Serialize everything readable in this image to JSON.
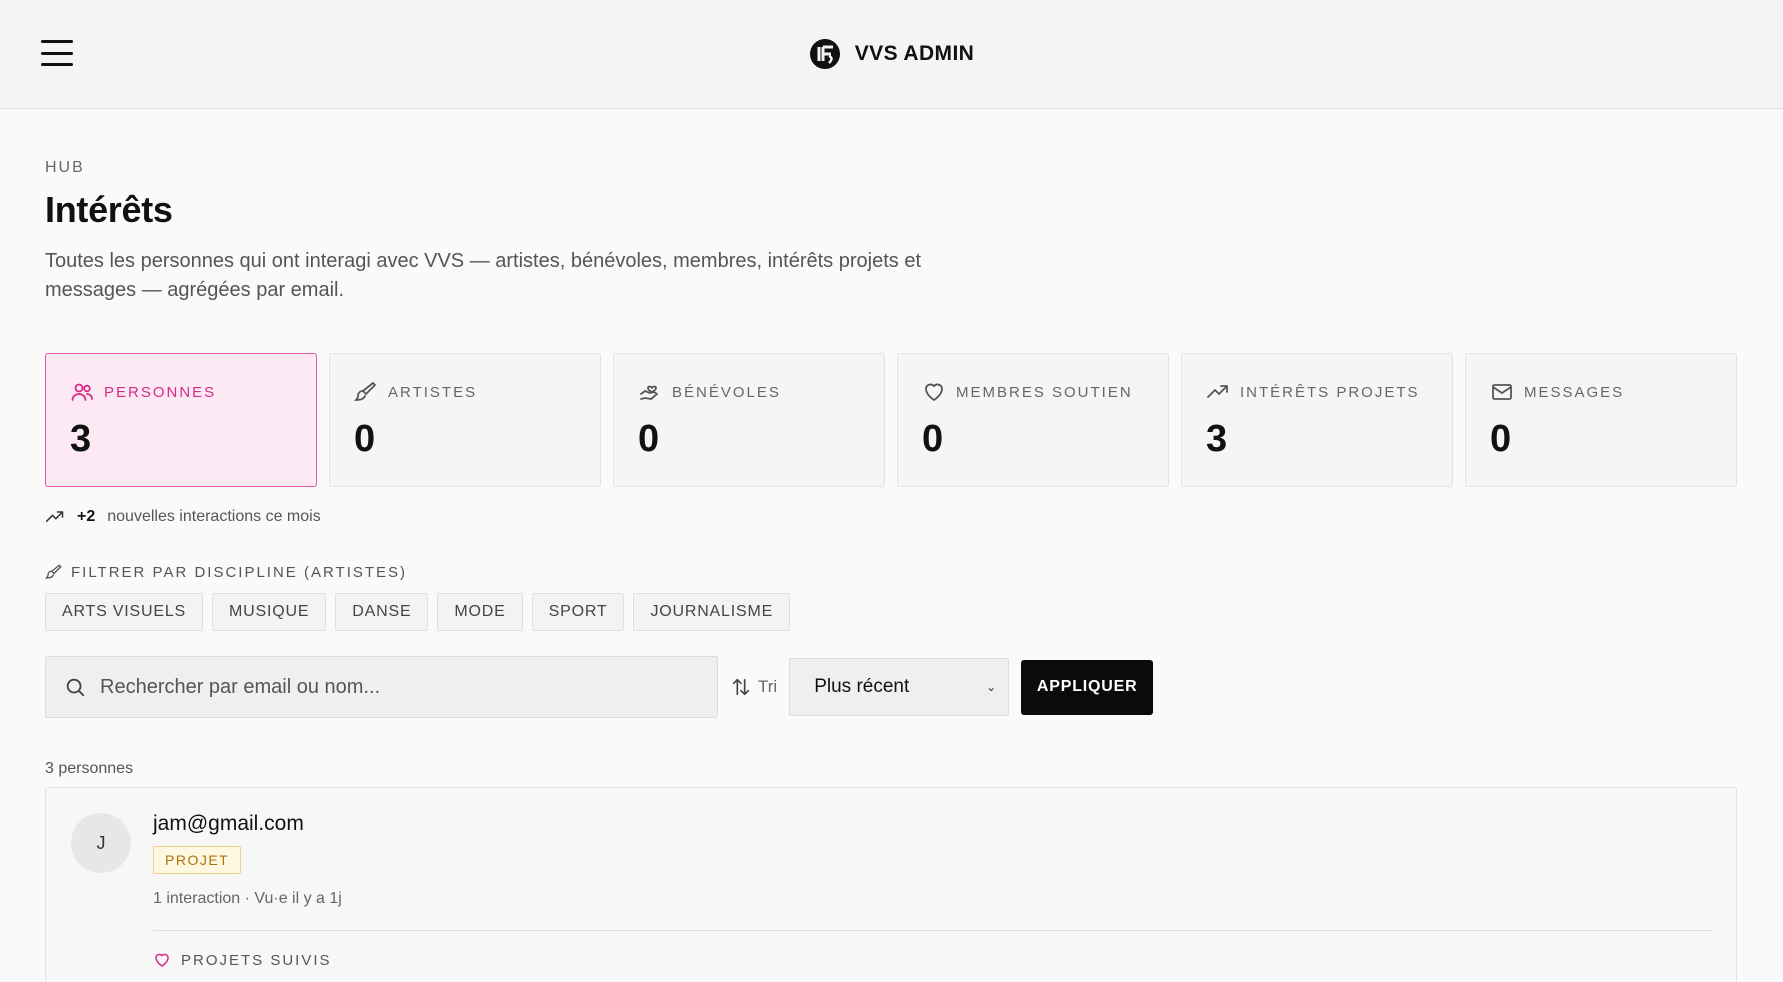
{
  "app": {
    "name": "VVS ADMIN"
  },
  "header": {
    "eyebrow": "HUB",
    "title": "Intérêts",
    "subtitle": "Toutes les personnes qui ont interagi avec VVS — artistes, bénévoles, membres, intérêts projets et messages — agrégées par email."
  },
  "stats": [
    {
      "label": "PERSONNES",
      "value": "3",
      "icon": "users-icon",
      "active": true
    },
    {
      "label": "ARTISTES",
      "value": "0",
      "icon": "brush-icon",
      "active": false
    },
    {
      "label": "BÉNÉVOLES",
      "value": "0",
      "icon": "hand-heart-icon",
      "active": false
    },
    {
      "label": "MEMBRES SOUTIEN",
      "value": "0",
      "icon": "heart-icon",
      "active": false
    },
    {
      "label": "INTÉRÊTS PROJETS",
      "value": "3",
      "icon": "trending-up-icon",
      "active": false
    },
    {
      "label": "MESSAGES",
      "value": "0",
      "icon": "mail-icon",
      "active": false
    }
  ],
  "trend": {
    "delta": "+2",
    "text": "nouvelles interactions ce mois"
  },
  "filter": {
    "label": "FILTRER PAR DISCIPLINE (ARTISTES)",
    "chips": [
      "ARTS VISUELS",
      "MUSIQUE",
      "DANSE",
      "MODE",
      "SPORT",
      "JOURNALISME"
    ]
  },
  "search": {
    "placeholder": "Rechercher par email ou nom...",
    "value": ""
  },
  "sort": {
    "label": "Tri",
    "selected": "Plus récent"
  },
  "apply_label": "APPLIQUER",
  "results": {
    "count_text": "3 personnes",
    "items": [
      {
        "initial": "J",
        "email": "jam@gmail.com",
        "badge": "PROJET",
        "meta": "1 interaction · Vu·e il y a 1j",
        "followed_label": "PROJETS SUIVIS"
      }
    ]
  },
  "colors": {
    "accent": "#d72b87",
    "accent_bg": "#fde9f3",
    "badge": "#b0710b"
  }
}
